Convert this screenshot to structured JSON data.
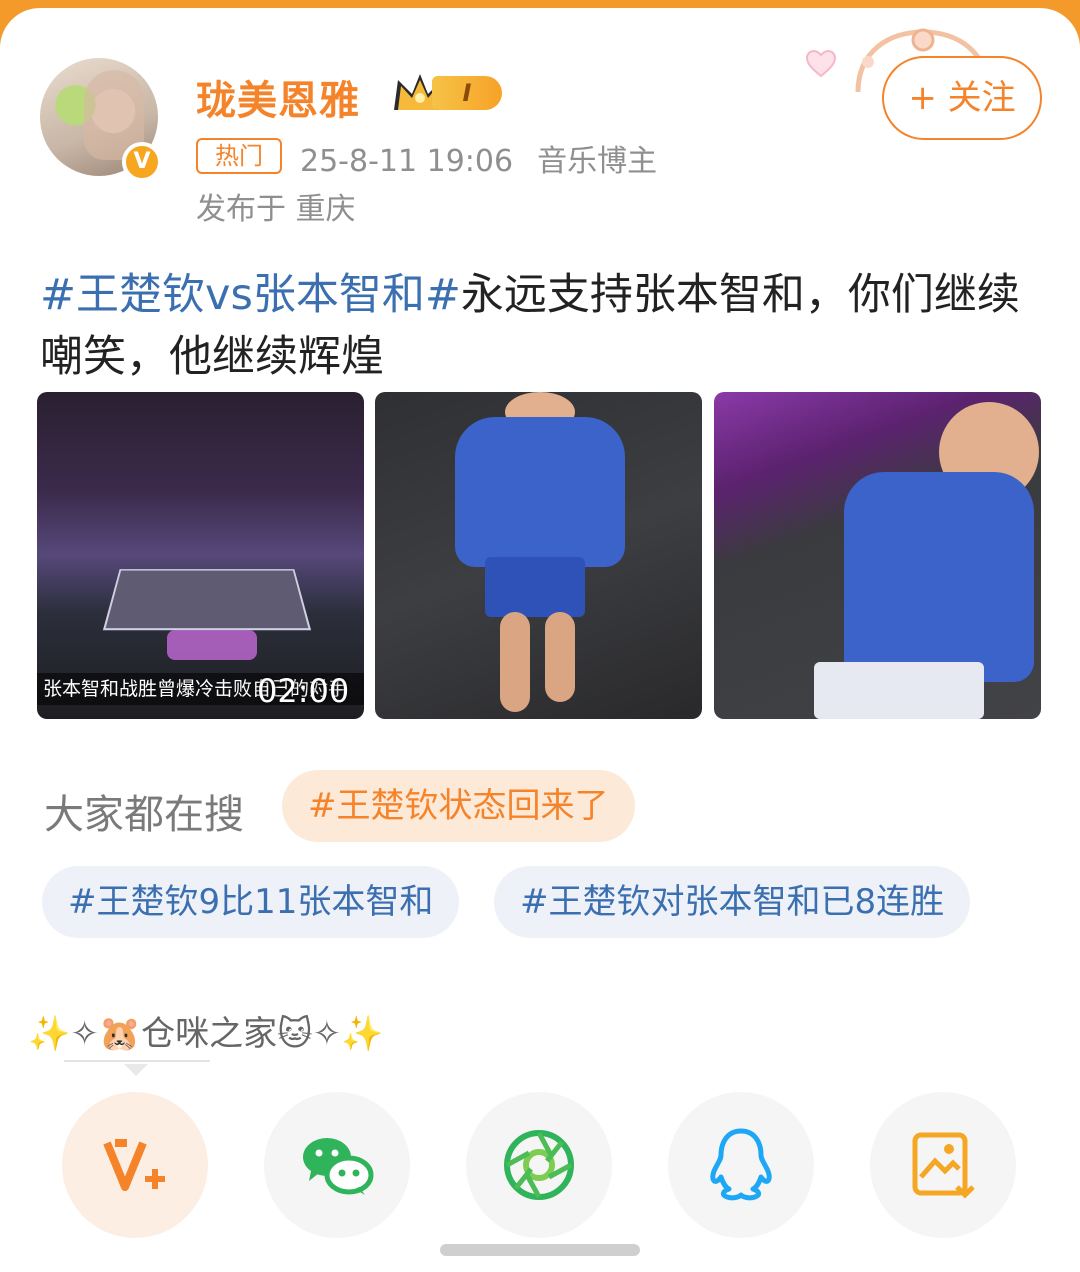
{
  "user": {
    "name": "珑美恩雅",
    "level_badge": "I",
    "hot_label": "热门",
    "timestamp": "25-8-11 19:06",
    "role": "音乐博主",
    "location": "发布于 重庆",
    "verified_badge": "V",
    "follow_label": "+ 关注"
  },
  "post": {
    "topic": "#王楚钦vs张本智和#",
    "body": "永远支持张本智和，你们继续嘲笑，他继续辉煌"
  },
  "media": {
    "video_duration": "02:00",
    "video_caption": "张本智和战胜曾爆冷击败自己的对手"
  },
  "search": {
    "label": "大家都在搜",
    "hot_topic": "#王楚钦状态回来了",
    "topics": [
      "#王楚钦9比11张本智和",
      "#王楚钦对张本智和已8连胜"
    ]
  },
  "group": {
    "name": "✨✧🐹仓咪之家🐱✧✨"
  },
  "share": {
    "items": [
      "v-plus-icon",
      "wechat-icon",
      "moments-icon",
      "qq-icon",
      "save-image-icon"
    ]
  },
  "colors": {
    "accent_orange": "#f5832a",
    "topic_blue": "#3b6fb0",
    "top_bar": "#f39a2b"
  }
}
